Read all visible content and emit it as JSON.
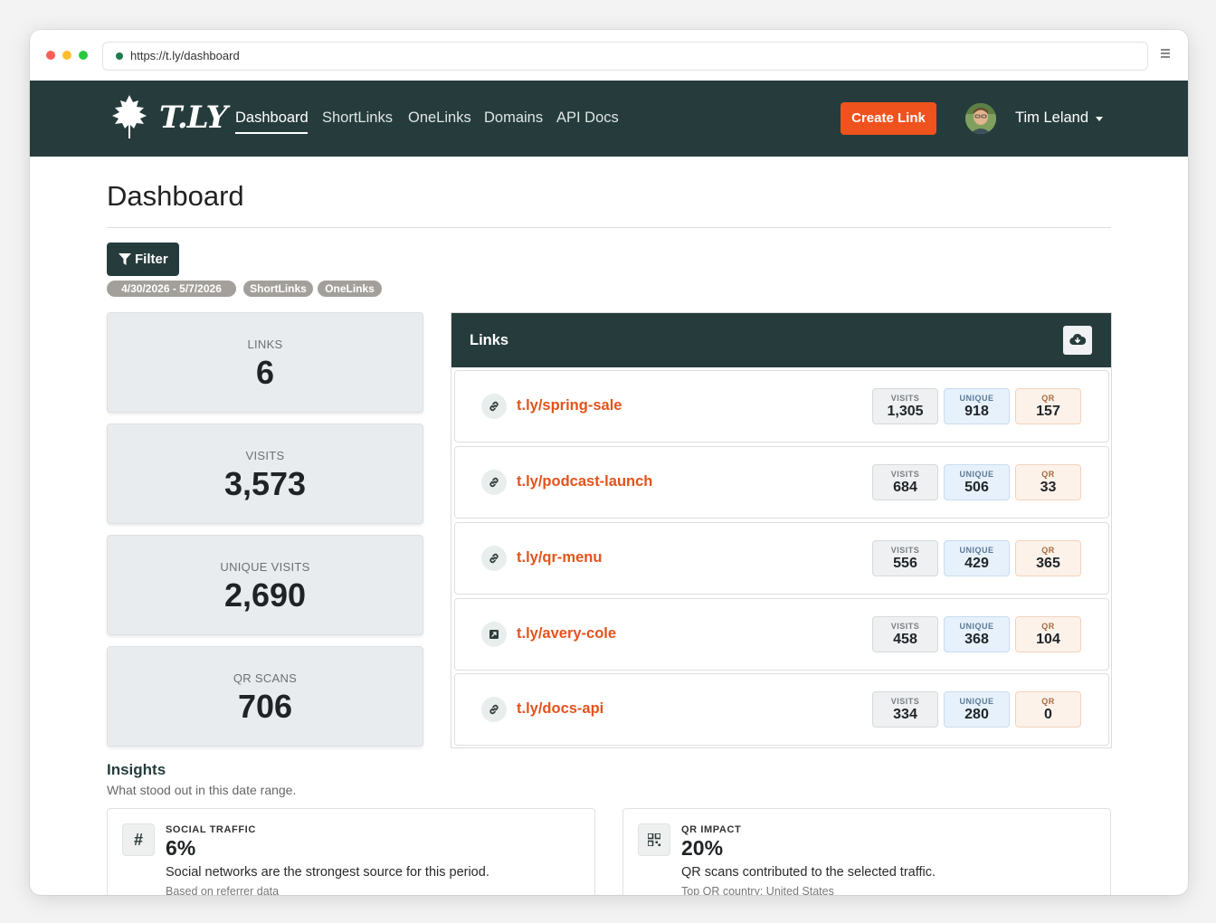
{
  "browser": {
    "url": "https://t.ly/dashboard"
  },
  "navbar": {
    "brand": "T.LY",
    "links": [
      "Dashboard",
      "ShortLinks",
      "OneLinks",
      "Domains",
      "API Docs"
    ],
    "create_label": "Create Link",
    "user_name": "Tim Leland"
  },
  "page": {
    "title": "Dashboard"
  },
  "filter": {
    "label": "Filter",
    "pills": [
      "4/30/2026 - 5/7/2026",
      "ShortLinks",
      "OneLinks"
    ]
  },
  "stats": [
    {
      "label": "LINKS",
      "value": "6"
    },
    {
      "label": "VISITS",
      "value": "3,573"
    },
    {
      "label": "UNIQUE VISITS",
      "value": "2,690"
    },
    {
      "label": "QR SCANS",
      "value": "706"
    }
  ],
  "links_panel": {
    "title": "Links",
    "metric_labels": {
      "visits": "VISITS",
      "unique": "UNIQUE",
      "qr": "QR"
    },
    "rows": [
      {
        "url": "t.ly/spring-sale",
        "icon": "link-icon",
        "visits": "1,305",
        "unique": "918",
        "qr": "157"
      },
      {
        "url": "t.ly/podcast-launch",
        "icon": "link-icon",
        "visits": "684",
        "unique": "506",
        "qr": "33"
      },
      {
        "url": "t.ly/qr-menu",
        "icon": "link-icon",
        "visits": "556",
        "unique": "429",
        "qr": "365"
      },
      {
        "url": "t.ly/avery-cole",
        "icon": "onelink-icon",
        "visits": "458",
        "unique": "368",
        "qr": "104"
      },
      {
        "url": "t.ly/docs-api",
        "icon": "link-icon",
        "visits": "334",
        "unique": "280",
        "qr": "0"
      }
    ]
  },
  "insights": {
    "title": "Insights",
    "subtitle": "What stood out in this date range.",
    "cards": [
      {
        "icon": "hash-icon",
        "glyph": "#",
        "kicker": "SOCIAL TRAFFIC",
        "value": "6%",
        "desc": "Social networks are the strongest source for this period.",
        "foot": "Based on referrer data"
      },
      {
        "icon": "qr-icon",
        "glyph": "",
        "kicker": "QR IMPACT",
        "value": "20%",
        "desc": "QR scans contributed to the selected traffic.",
        "foot": "Top QR country: United States"
      }
    ]
  },
  "colors": {
    "navbar": "#263c3c",
    "accent": "#f0521e",
    "link_text": "#e2531c"
  }
}
